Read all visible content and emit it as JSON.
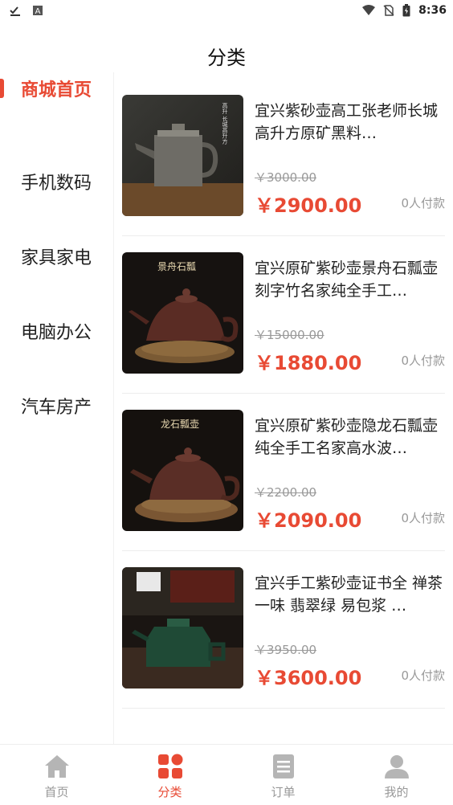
{
  "status_bar": {
    "time": "8:36",
    "left_icons": [
      "download-done-icon",
      "text-a-icon"
    ],
    "right_icons": [
      "wifi-icon",
      "no-sim-icon",
      "battery-icon"
    ]
  },
  "header": {
    "title": "分类"
  },
  "sidebar": {
    "items": [
      {
        "label": "商城首页",
        "active": true
      },
      {
        "label": "手机数码",
        "active": false
      },
      {
        "label": "家具家电",
        "active": false
      },
      {
        "label": "电脑办公",
        "active": false
      },
      {
        "label": "汽车房产",
        "active": false
      }
    ]
  },
  "products": [
    {
      "name": "宜兴紫砂壶高工张老师长城高升方原矿黑料…",
      "old_price": "￥3000.00",
      "price": "￥2900.00",
      "paid": "0人付款",
      "image_text": "高升 长城高升方"
    },
    {
      "name": "宜兴原矿紫砂壶景舟石瓢壶刻字竹名家纯全手工…",
      "old_price": "￥15000.00",
      "price": "￥1880.00",
      "paid": "0人付款",
      "image_text": "景舟石瓢"
    },
    {
      "name": "宜兴原矿紫砂壶隐龙石瓢壶纯全手工名家高水波…",
      "old_price": "￥2200.00",
      "price": "￥2090.00",
      "paid": "0人付款",
      "image_text": "龙石瓢壶"
    },
    {
      "name": "宜兴手工紫砂壶证书全 禅茶一味 翡翠绿 易包浆 …",
      "old_price": "￥3950.00",
      "price": "￥3600.00",
      "paid": "0人付款",
      "image_text": ""
    }
  ],
  "tabbar": {
    "items": [
      {
        "label": "首页",
        "icon": "home-icon",
        "active": false
      },
      {
        "label": "分类",
        "icon": "category-icon",
        "active": true
      },
      {
        "label": "订单",
        "icon": "order-list-icon",
        "active": false
      },
      {
        "label": "我的",
        "icon": "user-icon",
        "active": false
      }
    ]
  },
  "colors": {
    "accent": "#e84a34",
    "muted": "#999999",
    "tab_inactive": "#aaaaaa"
  }
}
